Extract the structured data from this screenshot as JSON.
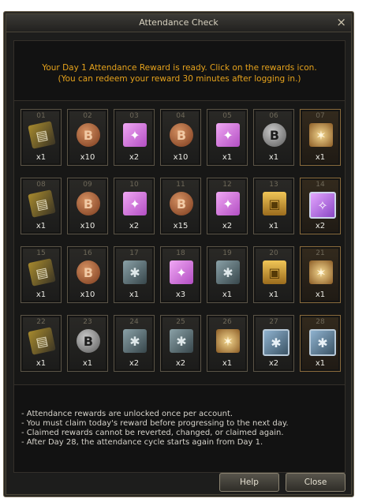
{
  "window": {
    "title": "Attendance Check",
    "close_icon": "×"
  },
  "notice": {
    "line1": "Your Day 1 Attendance Reward is ready. Click on the rewards icon.",
    "line2": "(You can redeem your reward 30 minutes after logging in.)"
  },
  "rewards": [
    {
      "day": "01",
      "qty": "x1",
      "icon": "ticket-icon"
    },
    {
      "day": "02",
      "qty": "x10",
      "icon": "bronze-coin-icon"
    },
    {
      "day": "03",
      "qty": "x2",
      "icon": "pink-scroll-icon"
    },
    {
      "day": "04",
      "qty": "x10",
      "icon": "bronze-coin-icon"
    },
    {
      "day": "05",
      "qty": "x1",
      "icon": "pink-scroll-icon"
    },
    {
      "day": "06",
      "qty": "x1",
      "icon": "silver-coin-icon"
    },
    {
      "day": "07",
      "qty": "x1",
      "icon": "crystal-icon"
    },
    {
      "day": "08",
      "qty": "x1",
      "icon": "ticket-icon"
    },
    {
      "day": "09",
      "qty": "x10",
      "icon": "bronze-coin-icon"
    },
    {
      "day": "10",
      "qty": "x2",
      "icon": "pink-scroll-icon"
    },
    {
      "day": "11",
      "qty": "x15",
      "icon": "bronze-coin-icon"
    },
    {
      "day": "12",
      "qty": "x2",
      "icon": "pink-scroll-icon"
    },
    {
      "day": "13",
      "qty": "x1",
      "icon": "chest-icon"
    },
    {
      "day": "14",
      "qty": "x2",
      "icon": "pink-box-icon"
    },
    {
      "day": "15",
      "qty": "x1",
      "icon": "ticket-icon"
    },
    {
      "day": "16",
      "qty": "x10",
      "icon": "bronze-coin-icon"
    },
    {
      "day": "17",
      "qty": "x1",
      "icon": "steel-scroll-icon"
    },
    {
      "day": "18",
      "qty": "x3",
      "icon": "pink-scroll-icon"
    },
    {
      "day": "19",
      "qty": "x1",
      "icon": "steel-scroll-icon"
    },
    {
      "day": "20",
      "qty": "x1",
      "icon": "chest-icon"
    },
    {
      "day": "21",
      "qty": "x1",
      "icon": "crystal-icon"
    },
    {
      "day": "22",
      "qty": "x1",
      "icon": "ticket-icon"
    },
    {
      "day": "23",
      "qty": "x1",
      "icon": "silver-coin-icon"
    },
    {
      "day": "24",
      "qty": "x2",
      "icon": "steel-scroll-icon"
    },
    {
      "day": "25",
      "qty": "x2",
      "icon": "steel-scroll-icon"
    },
    {
      "day": "26",
      "qty": "x1",
      "icon": "crystal-icon"
    },
    {
      "day": "27",
      "qty": "x2",
      "icon": "steel-box-icon"
    },
    {
      "day": "28",
      "qty": "x1",
      "icon": "steel-box-icon"
    }
  ],
  "rules": [
    "- Attendance rewards are unlocked once per account.",
    "- You must claim today's reward before progressing to the next day.",
    "- Claimed rewards cannot be reverted, changed, or claimed again.",
    "- After Day 28, the attendance cycle starts again from Day 1."
  ],
  "buttons": {
    "help": "Help",
    "close": "Close"
  },
  "colors": {
    "notice_text": "#e5a21c",
    "panel_bg": "#1d1d1c",
    "tile_border": "#5b5446"
  }
}
